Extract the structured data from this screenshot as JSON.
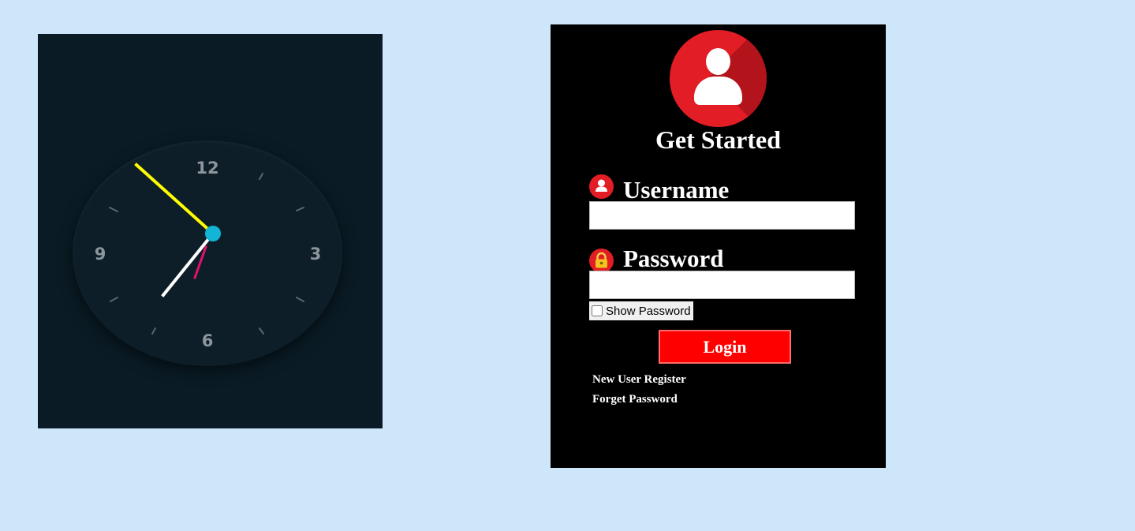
{
  "clock": {
    "numbers": [
      "12",
      "3",
      "6",
      "9"
    ],
    "hand_colors": {
      "hour": "#ffffff",
      "minute": "#ffff00",
      "second": "#e0126a",
      "center": "#12b5d6"
    }
  },
  "login": {
    "title": "Get Started",
    "username_label": "Username",
    "username_value": "",
    "password_label": "Password",
    "password_value": "",
    "show_password_label": "Show Password",
    "show_password_checked": false,
    "login_button": "Login",
    "register_link": "New User Register",
    "forgot_link": "Forget Password",
    "icons": [
      "user-avatar-icon",
      "user-icon",
      "lock-icon"
    ],
    "accent_color": "#ff0000"
  }
}
